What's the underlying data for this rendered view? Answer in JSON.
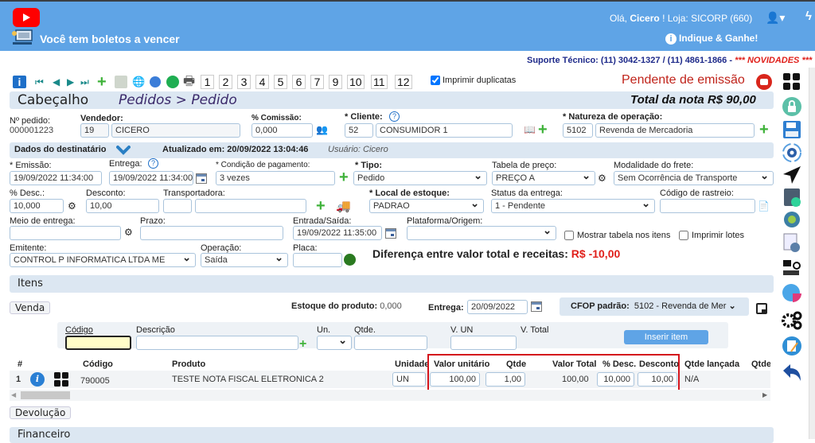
{
  "header": {
    "boletos_alert": "Você tem boletos a vencer",
    "greeting_prefix": "Olá,",
    "user_name": "Cicero",
    "greeting_suffix": "!  Loja: SICORP (660)",
    "indique": "Indique & Ganhe!",
    "suporte": "Suporte Técnico: (11) 3042-1327 / (11) 4861-1866 -",
    "novidades": "*** NOVIDADES ***"
  },
  "toolbar": {
    "pages": [
      "1",
      "2",
      "3",
      "4",
      "5",
      "6",
      "7",
      "9",
      "10",
      "11",
      "12"
    ],
    "imprimir_duplicatas": "Imprimir duplicatas",
    "imprimir_duplicatas_checked": true,
    "status": "Pendente de emissão"
  },
  "cabecalho": {
    "title": "Cabeçalho",
    "breadcrumb": "Pedidos > Pedido",
    "total_nota": "Total da nota R$ 90,00"
  },
  "form": {
    "pedido_label": "Nº pedido:",
    "pedido_value": "000001223",
    "vendedor_label": "Vendedor:",
    "vendedor_code": "19",
    "vendedor_name": "CICERO",
    "comissao_label": "% Comissão:",
    "comissao_value": "0,000",
    "cliente_label": "* Cliente:",
    "cliente_code": "52",
    "cliente_name": "CONSUMIDOR 1",
    "natureza_label": "* Natureza de operação:",
    "natureza_code": "5102",
    "natureza_name": "Revenda de Mercadoria",
    "dest_label": "Dados do destinatário",
    "atualizado": "Atualizado em: 20/09/2022 13:04:46",
    "usuario": "Usuário: Cicero",
    "emissao_label": "* Emissão:",
    "emissao_value": "19/09/2022 11:34:00",
    "entrega_label": "Entrega:",
    "entrega_value": "19/09/2022 11:34:00",
    "condicao_label": "* Condição de pagamento:",
    "condicao_value": "3 vezes",
    "tipo_label": "* Tipo:",
    "tipo_value": "Pedido",
    "tabela_label": "Tabela de preço:",
    "tabela_value": "PREÇO A",
    "frete_label": "Modalidade do frete:",
    "frete_value": "Sem Ocorrência de Transporte",
    "desc_pct_label": "% Desc.:",
    "desc_pct_value": "10,000",
    "desconto_label": "Desconto:",
    "desconto_value": "10,00",
    "transportadora_label": "Transportadora:",
    "transportadora_code": "",
    "transportadora_name": "",
    "local_label": "* Local de estoque:",
    "local_value": "PADRAO",
    "status_entrega_label": "Status da entrega:",
    "status_entrega_value": "1 - Pendente",
    "rastreio_label": "Código de rastreio:",
    "rastreio_value": "",
    "meio_label": "Meio de entrega:",
    "meio_value": "",
    "prazo_label": "Prazo:",
    "prazo_value": "",
    "entrada_label": "Entrada/Saída:",
    "entrada_value": "19/09/2022 11:35:00",
    "plataforma_label": "Plataforma/Origem:",
    "plataforma_value": "",
    "mostrar_tabela": "Mostrar tabela nos itens",
    "imprimir_lotes": "Imprimir lotes",
    "emitente_label": "Emitente:",
    "emitente_value": "CONTROL P INFORMATICA LTDA ME",
    "operacao_label": "Operação:",
    "operacao_value": "Saída",
    "placa_label": "Placa:",
    "placa_value": "",
    "diferenca_label": "Diferença entre valor total e receitas:",
    "diferenca_value": "R$ -10,00"
  },
  "itens": {
    "title": "Itens",
    "venda_button": "Venda",
    "estoque_label": "Estoque do produto:",
    "estoque_value": "0,000",
    "entrega_label": "Entrega:",
    "entrega_value": "20/09/2022",
    "cfop_label": "CFOP padrão:",
    "cfop_value": "5102 - Revenda de Mer",
    "add": {
      "codigo_label": "Código",
      "descricao_label": "Descrição",
      "un_label": "Un.",
      "qtde_label": "Qtde.",
      "vun_label": "V. UN",
      "vtotal_label": "V. Total",
      "inserir_button": "Inserir item"
    },
    "columns": [
      "#",
      "Código",
      "Produto",
      "Unidade",
      "Valor unitário",
      "Qtde",
      "Valor Total",
      "% Desc.",
      "Desconto",
      "Qtde lançada",
      "Qtde e"
    ],
    "rows": [
      {
        "num": "1",
        "codigo": "790005",
        "produto": "TESTE NOTA FISCAL ELETRONICA 2",
        "unidade": "UN",
        "valor_unitario": "100,00",
        "qtde": "1,00",
        "valor_total": "100,00",
        "desc_pct": "10,000",
        "desconto": "10,00",
        "qtde_lancada": "N/A"
      }
    ],
    "devolucao_button": "Devolução"
  },
  "financeiro": {
    "title": "Financeiro"
  }
}
